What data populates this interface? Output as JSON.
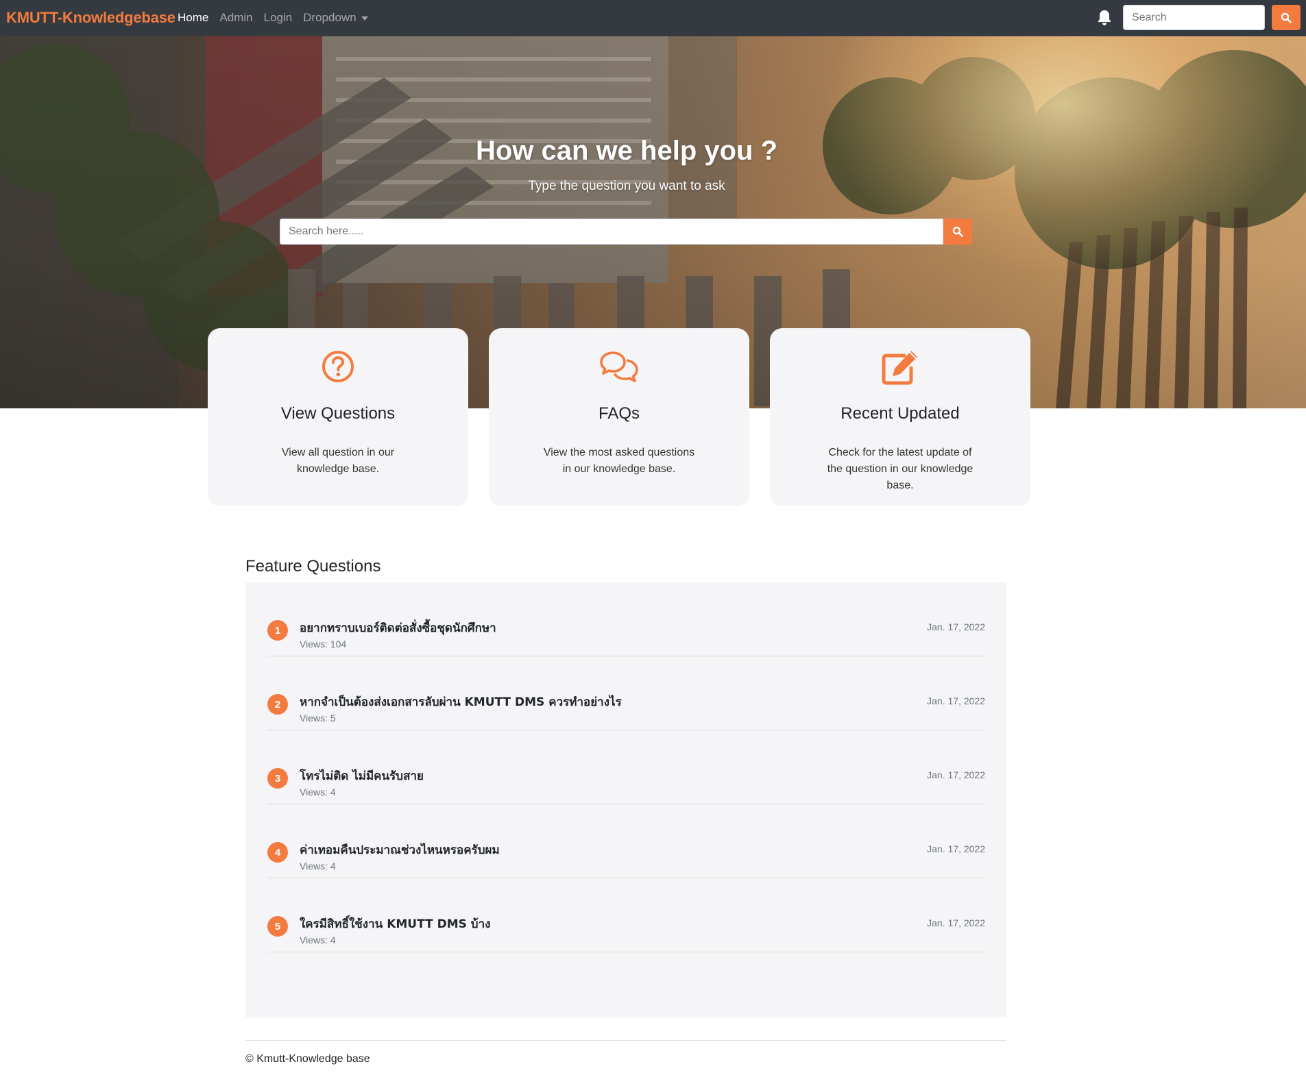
{
  "navbar": {
    "brand": "KMUTT-Knowledgebase",
    "links": [
      "Home",
      "Admin",
      "Login",
      "Dropdown"
    ],
    "search_placeholder": "Search"
  },
  "hero": {
    "title": "How can we help you ?",
    "subtitle": "Type the question you want to ask",
    "search_placeholder": "Search here....."
  },
  "cards": [
    {
      "title": "View Questions",
      "desc": "View all question in our knowledge base.",
      "icon": "question-circle-icon"
    },
    {
      "title": "FAQs",
      "desc": "View the most asked questions in our knowledge base.",
      "icon": "comments-icon"
    },
    {
      "title": "Recent Updated",
      "desc": "Check for the latest update of the question in our knowledge base.",
      "icon": "edit-icon"
    }
  ],
  "feature": {
    "title": "Feature Questions",
    "questions": [
      {
        "num": "1",
        "text": "อยากทราบเบอร์ติดต่อสั่งซื้อชุดนักศึกษา",
        "views": "Views: 104",
        "date": "Jan. 17, 2022"
      },
      {
        "num": "2",
        "text": "หากจำเป็นต้องส่งเอกสารลับผ่าน KMUTT DMS ควรทำอย่างไร",
        "views": "Views: 5",
        "date": "Jan. 17, 2022"
      },
      {
        "num": "3",
        "text": "โทรไม่ติด ไม่มีคนรับสาย",
        "views": "Views: 4",
        "date": "Jan. 17, 2022"
      },
      {
        "num": "4",
        "text": "ค่าเทอมคืนประมาณช่วงไหนหรอครับผม",
        "views": "Views: 4",
        "date": "Jan. 17, 2022"
      },
      {
        "num": "5",
        "text": "ใครมีสิทธิ์ใช้งาน KMUTT DMS บ้าง",
        "views": "Views: 4",
        "date": "Jan. 17, 2022"
      }
    ]
  },
  "footer": {
    "text": "© Kmutt-Knowledge base"
  },
  "colors": {
    "accent": "#f47b3f",
    "navbar": "#343a40",
    "card_bg": "#f5f5f7"
  }
}
